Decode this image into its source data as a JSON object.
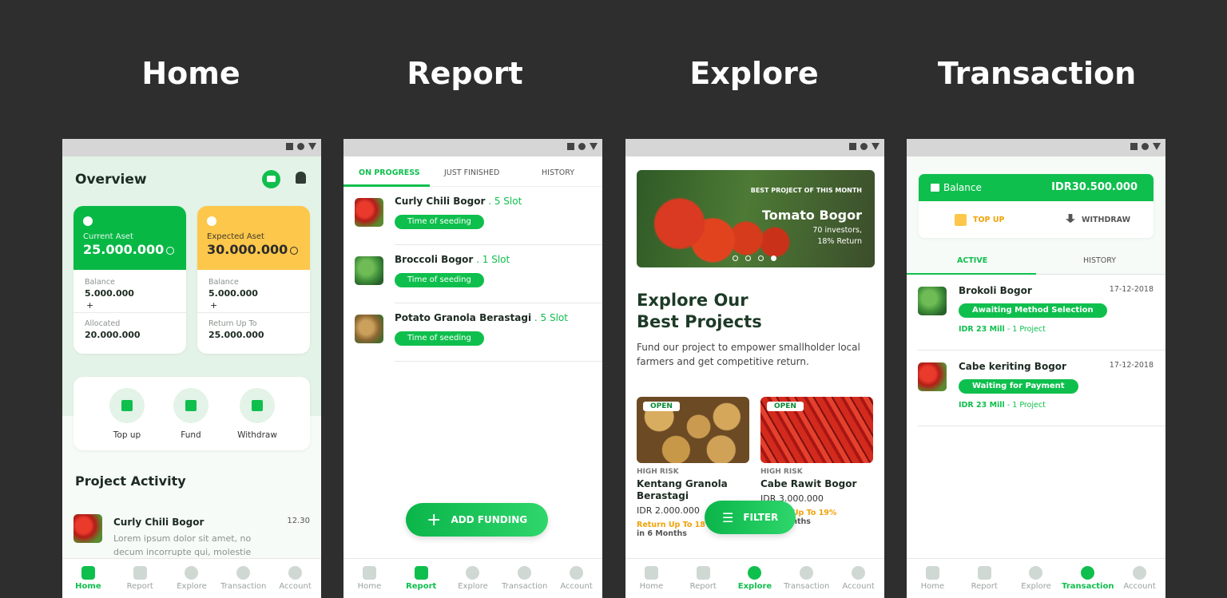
{
  "titles": [
    "Home",
    "Report",
    "Explore",
    "Transaction"
  ],
  "nav_labels": [
    "Home",
    "Report",
    "Explore",
    "Transaction",
    "Account"
  ],
  "home": {
    "overview": "Overview",
    "card_current": {
      "label": "Current Aset",
      "value": "25.000.000",
      "balance_label": "Balance",
      "balance": "5.000.000",
      "plus": "+",
      "second_label": "Allocated",
      "second": "20.000.000"
    },
    "card_expected": {
      "label": "Expected Aset",
      "value": "30.000.000",
      "balance_label": "Balance",
      "balance": "5.000.000",
      "plus": "+",
      "second_label": "Return Up To",
      "second": "25.000.000"
    },
    "actions": [
      "Top up",
      "Fund",
      "Withdraw"
    ],
    "activity_title": "Project Activity",
    "activity": {
      "name": "Curly Chili Bogor",
      "time": "12.30",
      "desc": "Lorem ipsum dolor sit amet, no decum incorrupte qui, molestie"
    }
  },
  "report": {
    "tabs": [
      "ON PROGRESS",
      "JUST FINISHED",
      "HISTORY"
    ],
    "items": [
      {
        "name": "Curly Chili Bogor",
        "slot": " . 5 Slot",
        "status": "Time of seeding"
      },
      {
        "name": "Broccoli  Bogor",
        "slot": " . 1 Slot",
        "status": "Time of seeding"
      },
      {
        "name": "Potato Granola Berastagi",
        "slot": " . 5 Slot",
        "status": "Time of seeding"
      }
    ],
    "fab": "ADD FUNDING"
  },
  "explore": {
    "banner": {
      "small": "BEST PROJECT OF THIS MONTH",
      "title": "Tomato Bogor",
      "investors": "70 investors,",
      "return": "18% Return"
    },
    "title_l1": "Explore Our",
    "title_l2": "Best Projects",
    "desc": "Fund our project to empower smallholder local farmers and get competitive return.",
    "products": [
      {
        "badge": "OPEN",
        "risk": "HIGH RISK",
        "name": "Kentang Granola Berastagi",
        "price": "IDR 2.000.000",
        "return": "Return Up To 18%",
        "months": "in 6 Months"
      },
      {
        "badge": "OPEN",
        "risk": "HIGH RISK",
        "name": "Cabe Rawit Bogor",
        "price": "IDR 3.000.000",
        "return": "Return Up To 19%",
        "months": "in 6 Months"
      }
    ],
    "fab": "FILTER"
  },
  "transaction": {
    "balance_label": "Balance",
    "balance_value": "IDR30.500.000",
    "topup": "TOP UP",
    "withdraw": "WITHDRAW",
    "tabs": [
      "ACTIVE",
      "HISTORY"
    ],
    "items": [
      {
        "name": "Brokoli Bogor",
        "date": "17-12-2018",
        "status": "Awaiting Method Selection",
        "amount": "IDR 23 Mill",
        "project": " - 1 Project"
      },
      {
        "name": "Cabe keriting Bogor",
        "date": "17-12-2018",
        "status": "Waiting for Payment",
        "amount": "IDR 23 Mill",
        "project": " - 1 Project"
      }
    ]
  },
  "colors": {
    "brand_green": "#0fbf4d",
    "card_yellow": "#fdc74b",
    "return_orange": "#f0a30a",
    "background": "#2e2e2e"
  }
}
